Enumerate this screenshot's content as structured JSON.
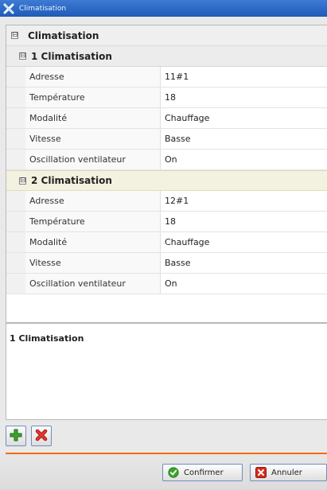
{
  "window": {
    "title": "Climatisation"
  },
  "tree": {
    "root_label": "Climatisation",
    "root_toggle": "⊟",
    "groups": [
      {
        "label": "1 Climatisation",
        "toggle": "⊟",
        "rows": [
          {
            "label": "Adresse",
            "value": "11#1"
          },
          {
            "label": "Température",
            "value": "18"
          },
          {
            "label": "Modalité",
            "value": "Chauffage"
          },
          {
            "label": "Vitesse",
            "value": "Basse"
          },
          {
            "label": "Oscillation ventilateur",
            "value": "On"
          }
        ]
      },
      {
        "label": "2 Climatisation",
        "toggle": "⊟",
        "rows": [
          {
            "label": "Adresse",
            "value": "12#1"
          },
          {
            "label": "Température",
            "value": "18"
          },
          {
            "label": "Modalité",
            "value": "Chauffage"
          },
          {
            "label": "Vitesse",
            "value": "Basse"
          },
          {
            "label": "Oscillation ventilateur",
            "value": "On"
          }
        ]
      }
    ]
  },
  "description": {
    "text": "1 Climatisation"
  },
  "toolbar": {
    "add_icon": "plus-icon",
    "delete_icon": "x-icon"
  },
  "footer": {
    "confirm_label": "Confirmer",
    "cancel_label": "Annuler"
  },
  "colors": {
    "accent_orange": "#f36b00",
    "title_blue": "#1f5ab8",
    "add_green": "#3aa52c",
    "delete_red": "#d62a1e"
  }
}
